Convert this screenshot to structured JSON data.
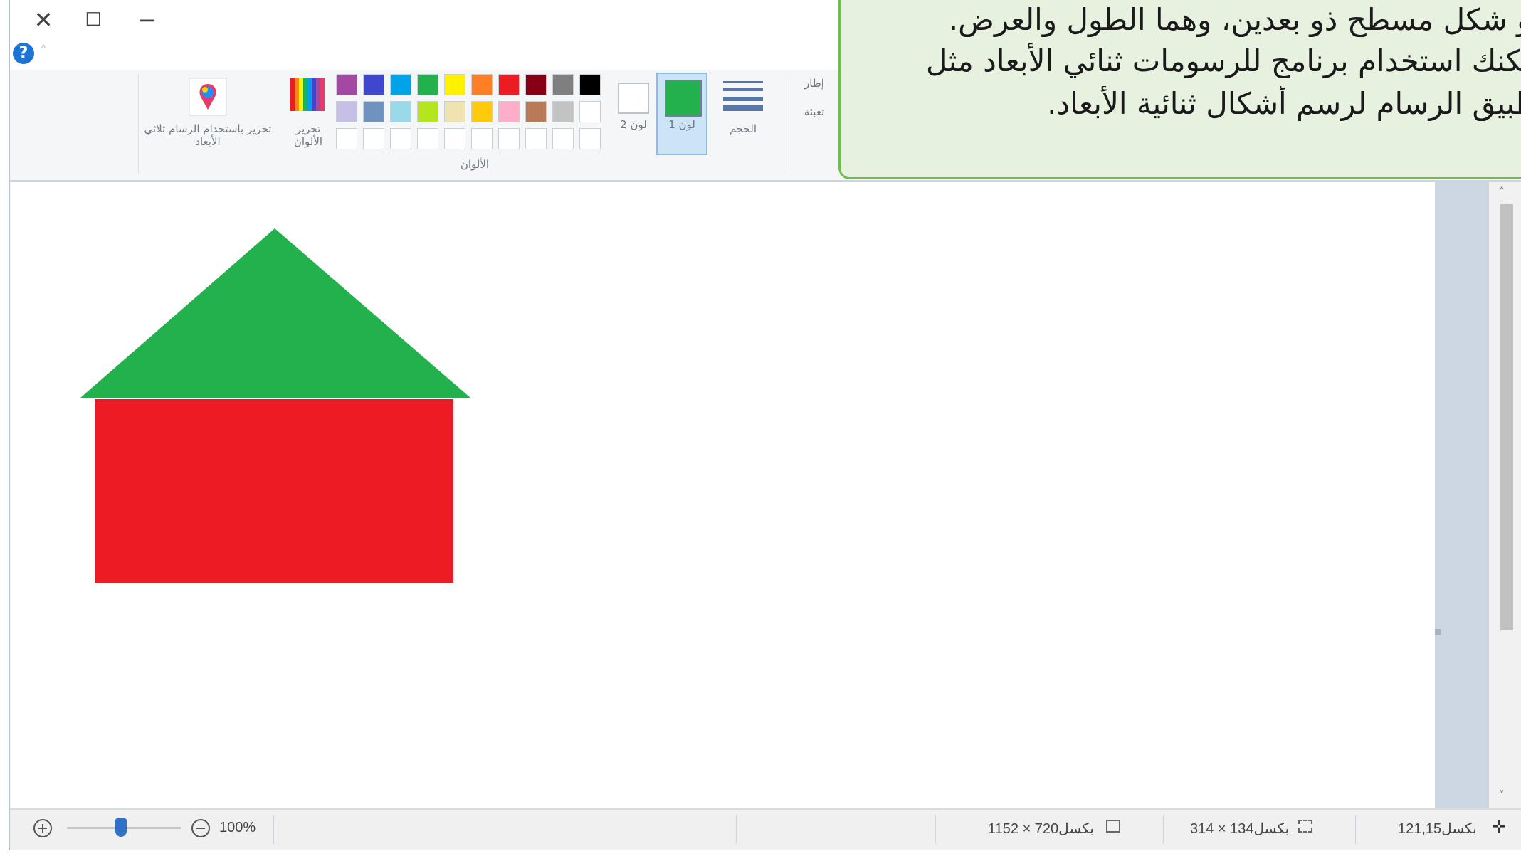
{
  "window": {
    "close_glyph": "✕",
    "maximize_glyph": "☐",
    "minimize_glyph": "−",
    "help_glyph": "?",
    "collapse_glyph": "˄"
  },
  "ribbon": {
    "paint3d_label": "تحرير باستخدام الرسام ثلاثي الأبعاد",
    "edit_colors_label": "تحرير الألوان",
    "color2_label": "لون 2",
    "color1_label": "لون 1",
    "size_label": "الحجم",
    "colors_group_label": "الألوان",
    "outline_label": "إطار",
    "fill_label": "تعبئة",
    "color1_value": "#22b14c",
    "color2_value": "#ffffff",
    "palette_row1": [
      "#a349a4",
      "#3f48cc",
      "#00a2e8",
      "#22b14c",
      "#fff200",
      "#ff7f27",
      "#ed1c24",
      "#880015",
      "#7f7f7f",
      "#000000"
    ],
    "palette_row2": [
      "#c8bfe7",
      "#7092be",
      "#99d9ea",
      "#b5e61d",
      "#efe4b0",
      "#ffc90e",
      "#ffaec9",
      "#b97a57",
      "#c3c3c3",
      "#ffffff"
    ],
    "palette_row3": [
      "#ffffff",
      "#ffffff",
      "#ffffff",
      "#ffffff",
      "#ffffff",
      "#ffffff",
      "#ffffff",
      "#ffffff",
      "#ffffff",
      "#ffffff"
    ]
  },
  "canvas": {
    "roof_color": "#22b14c",
    "body_color": "#ed1c24"
  },
  "status": {
    "zoom": "100%",
    "image_size": "1152 × 720بكسل",
    "selection_size": "314 × 134بكسل",
    "cursor_pos": "121,15بكسل"
  },
  "callout": {
    "line1": "هو شكل مسطح ذو بعدين، وهما الطول والعرض.",
    "line2": "يمكنك استخدام برنامجٍ للرسومات ثنائي الأبعاد مثل",
    "line3": "تطبيق الرسام لرسم أشكال ثنائية الأبعاد."
  }
}
